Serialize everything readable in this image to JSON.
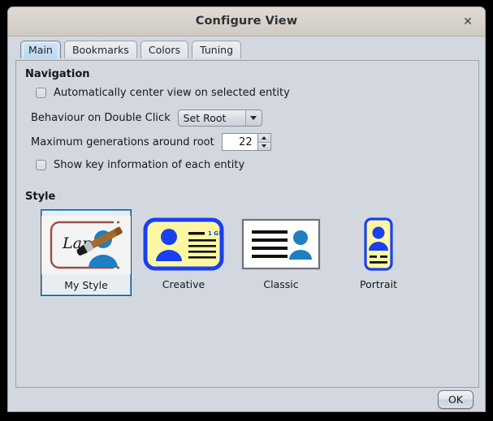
{
  "window": {
    "title": "Configure View",
    "close_icon": "close-icon",
    "close_glyph": "✕"
  },
  "tabs": [
    {
      "label": "Main",
      "selected": true
    },
    {
      "label": "Bookmarks",
      "selected": false
    },
    {
      "label": "Colors",
      "selected": false
    },
    {
      "label": "Tuning",
      "selected": false
    }
  ],
  "navigation": {
    "section_label": "Navigation",
    "auto_center": {
      "label": "Automatically center view on selected entity",
      "checked": false
    },
    "double_click": {
      "label": "Behaviour on Double Click",
      "value": "Set Root",
      "options": [
        "Set Root"
      ]
    },
    "max_generations": {
      "label": "Maximum generations around root",
      "value": "22"
    },
    "show_key_info": {
      "label": "Show key information of each entity",
      "checked": false
    }
  },
  "style": {
    "section_label": "Style",
    "items": [
      {
        "label": "My Style",
        "selected": true,
        "icon": "my-style-icon"
      },
      {
        "label": "Creative",
        "selected": false,
        "icon": "creative-icon"
      },
      {
        "label": "Classic",
        "selected": false,
        "icon": "classic-icon"
      },
      {
        "label": "Portrait",
        "selected": false,
        "icon": "portrait-icon"
      }
    ]
  },
  "footer": {
    "ok_label": "OK"
  },
  "colors": {
    "titlebar": "#d7d3cb",
    "dialog_bg": "#d3d8e0",
    "tab_selected": "#c6dff2",
    "accent_blue": "#1a3ff0",
    "thumb_yellow": "#fdf7a4",
    "person_blue": "#1f7fc0",
    "brush_brown": "#a9682b",
    "frame_red": "#9e4a4a"
  }
}
